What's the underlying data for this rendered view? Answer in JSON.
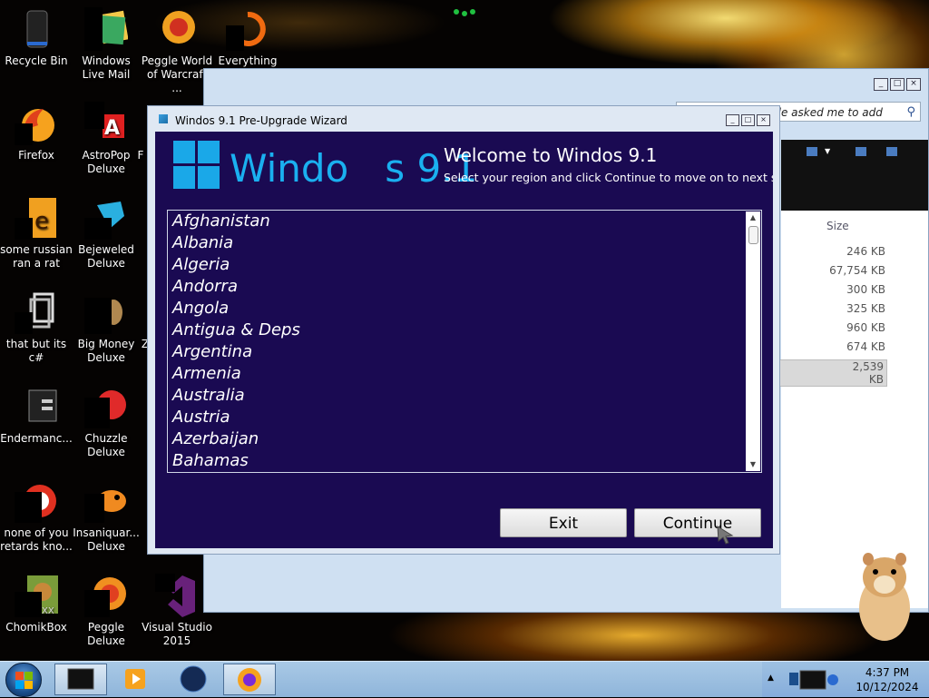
{
  "desktop": {
    "icons": [
      {
        "label": "Recycle Bin",
        "icon": "recycle-bin-icon"
      },
      {
        "label": "Windows Live Mail",
        "icon": "mail-icon"
      },
      {
        "label": "Peggle World of Warcraft ...",
        "icon": "peggle-icon"
      },
      {
        "label": "Everything",
        "icon": "everything-icon"
      },
      {
        "label": "Firefox",
        "icon": "firefox-icon"
      },
      {
        "label": "AstroPop Deluxe",
        "icon": "astropop-icon"
      },
      {
        "label": "F",
        "icon": "partial-icon"
      },
      {
        "label": "some russian ran a rat",
        "icon": "game-icon"
      },
      {
        "label": "Bejeweled Deluxe",
        "icon": "bejeweled-icon"
      },
      {
        "label": "that but its c#",
        "icon": "shortcut-icon"
      },
      {
        "label": "Big Money Deluxe",
        "icon": "bigmoney-icon"
      },
      {
        "label": "Z",
        "icon": "partial-icon"
      },
      {
        "label": "Endermanc...",
        "icon": "enderman-icon"
      },
      {
        "label": "Chuzzle Deluxe",
        "icon": "chuzzle-icon"
      },
      {
        "label": "none of you retards kno...",
        "icon": "app-icon"
      },
      {
        "label": "Insaniquar... Deluxe",
        "icon": "insaniquarium-icon"
      },
      {
        "label": "ChomikBox",
        "icon": "chomikbox-icon"
      },
      {
        "label": "Peggle Deluxe",
        "icon": "peggle-icon"
      },
      {
        "label": "Visual Studio 2015",
        "icon": "visual-studio-icon"
      }
    ]
  },
  "explorer": {
    "search_text": "ple asked me to add",
    "size_header": "Size",
    "sizes": [
      "246 KB",
      "67,754 KB",
      "300 KB",
      "325 KB",
      "960 KB",
      "674 KB",
      "2,539 KB"
    ]
  },
  "wizard": {
    "window_title": "Windos 9.1 Pre-Upgrade Wizard",
    "logo_text": "Windo   s 9.1",
    "heading": "Welcome to Windos 9.1",
    "subtitle": "Select your region and click Continue to move on to next steps",
    "regions": [
      "Afghanistan",
      "Albania",
      "Algeria",
      "Andorra",
      "Angola",
      "Antigua & Deps",
      "Argentina",
      "Armenia",
      "Australia",
      "Austria",
      "Azerbaijan",
      "Bahamas"
    ],
    "exit_label": "Exit",
    "continue_label": "Continue",
    "colors": {
      "background": "#1a0a52",
      "logo": "#1ab0f0"
    }
  },
  "taskbar": {
    "time": "4:37 PM",
    "date": "10/12/2024",
    "pinned": [
      "terminal-icon",
      "media-player-icon",
      "globe-icon",
      "firefox-icon"
    ]
  }
}
